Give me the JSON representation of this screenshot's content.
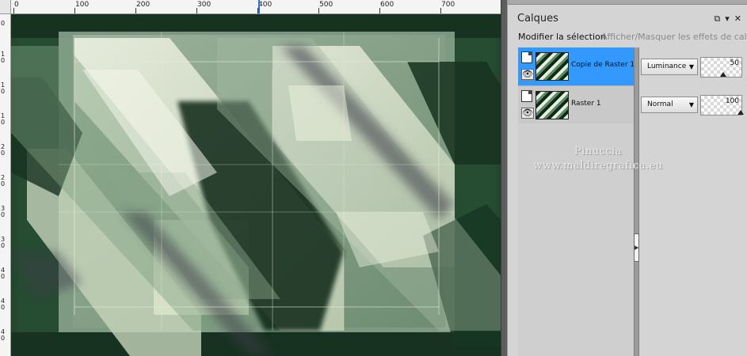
{
  "ruler": {
    "labels": [
      "0",
      "100",
      "200",
      "300",
      "400",
      "500",
      "600",
      "700"
    ],
    "marker_value": 400,
    "vertical_labels": [
      "0",
      "1\n0",
      "1\n0",
      "1\n0",
      "2\n0",
      "2\n0",
      "3\n0",
      "3\n0",
      "4\n0",
      "4\n0",
      "4\n0"
    ]
  },
  "panel": {
    "title": "Calques",
    "controls": [
      "⧉",
      "▾",
      "✕"
    ],
    "link_modify": "Modifier la sélection",
    "link_effects": "Afficher/Masquer les effets de calque"
  },
  "layers": [
    {
      "name": "Copie de Raster 1",
      "blend_mode": "Luminance",
      "opacity": 50,
      "selected": true
    },
    {
      "name": "Raster 1",
      "blend_mode": "Normal",
      "opacity": 100,
      "selected": false
    }
  ],
  "watermark": {
    "line1": "Pinuccia",
    "line2": "www.maldiregrafica.eu"
  },
  "icons": {
    "eye": "eye-icon",
    "page": "layer-page-icon",
    "dropdown": "chevron-down-icon",
    "splitter": "collapse-arrow-icon"
  },
  "colors": {
    "selection": "#3399ff",
    "panel_bg": "#d4d4d4",
    "canvas_dark": "#0e2a18",
    "canvas_light": "#e8eedc",
    "canvas_mid": "#5d8a66"
  }
}
